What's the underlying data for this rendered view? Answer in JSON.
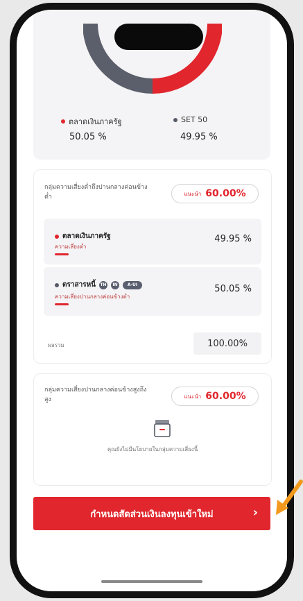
{
  "allocation": {
    "legend": [
      {
        "label": "ตลาดเงินภาครัฐ",
        "value": "50.05 %",
        "color": "#e1262d"
      },
      {
        "label": "SET 50",
        "value": "49.95 %",
        "color": "#555b67"
      }
    ],
    "chart_colors": {
      "primary": "#e1262d",
      "secondary": "#5b5f6b"
    }
  },
  "low_risk_group": {
    "title": "กลุ่มความเสี่ยงต่ำถึงปานกลางค่อนข้างต่ำ",
    "recommend_label": "แนะนำ",
    "recommend_value": "60.00%",
    "assets": [
      {
        "name": "ตลาดเงินภาครัฐ",
        "risk": "ความเสี่ยงต่ำ",
        "value": "49.95 %"
      },
      {
        "name": "ตราสารหนี้",
        "risk": "ความเสี่ยงปานกลางค่อนข้างต่ำ",
        "value": "50.05 %",
        "tags": [
          "TH",
          "IN",
          "A-UI"
        ]
      }
    ],
    "total_label": "ผลรวม",
    "total_value": "100.00%"
  },
  "medium_high_group": {
    "title": "กลุ่มความเสี่ยงปานกลางค่อนข้างสูงถึงสูง",
    "recommend_label": "แนะนำ",
    "recommend_value": "60.00%",
    "empty_icon": "empty-box-icon",
    "empty_text": "คุณยังไม่มีนโยบายในกลุ่มความเสี่ยงนี้"
  },
  "cta": {
    "label": "กำหนดสัดส่วนเงินลงทุนเข้าใหม่",
    "chevron": "›"
  },
  "colors": {
    "brand_red": "#e1262d",
    "annotation_arrow": "#f39a1e"
  }
}
